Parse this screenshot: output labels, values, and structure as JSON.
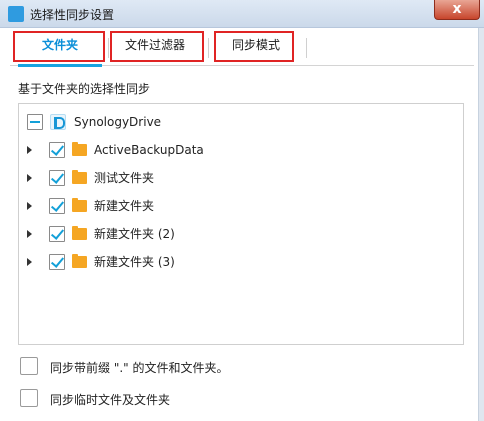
{
  "window": {
    "title": "选择性同步设置",
    "close_glyph": "x"
  },
  "tabs": [
    {
      "label": "文件夹",
      "active": true
    },
    {
      "label": "文件过滤器",
      "active": false
    },
    {
      "label": "同步模式",
      "active": false
    }
  ],
  "section": {
    "label": "基于文件夹的选择性同步"
  },
  "tree": {
    "root": {
      "label": "SynologyDrive",
      "state": "partial"
    },
    "items": [
      {
        "label": "ActiveBackupData",
        "checked": true
      },
      {
        "label": "测试文件夹",
        "checked": true
      },
      {
        "label": "新建文件夹",
        "checked": true
      },
      {
        "label": "新建文件夹 (2)",
        "checked": true
      },
      {
        "label": "新建文件夹 (3)",
        "checked": true
      }
    ]
  },
  "options": [
    {
      "label": "同步带前缀 \".\" 的文件和文件夹。",
      "checked": false
    },
    {
      "label": "同步临时文件及文件夹",
      "checked": false
    }
  ],
  "colors": {
    "accent": "#17a3e0",
    "highlight_box": "#e02424",
    "folder": "#f5a623"
  }
}
